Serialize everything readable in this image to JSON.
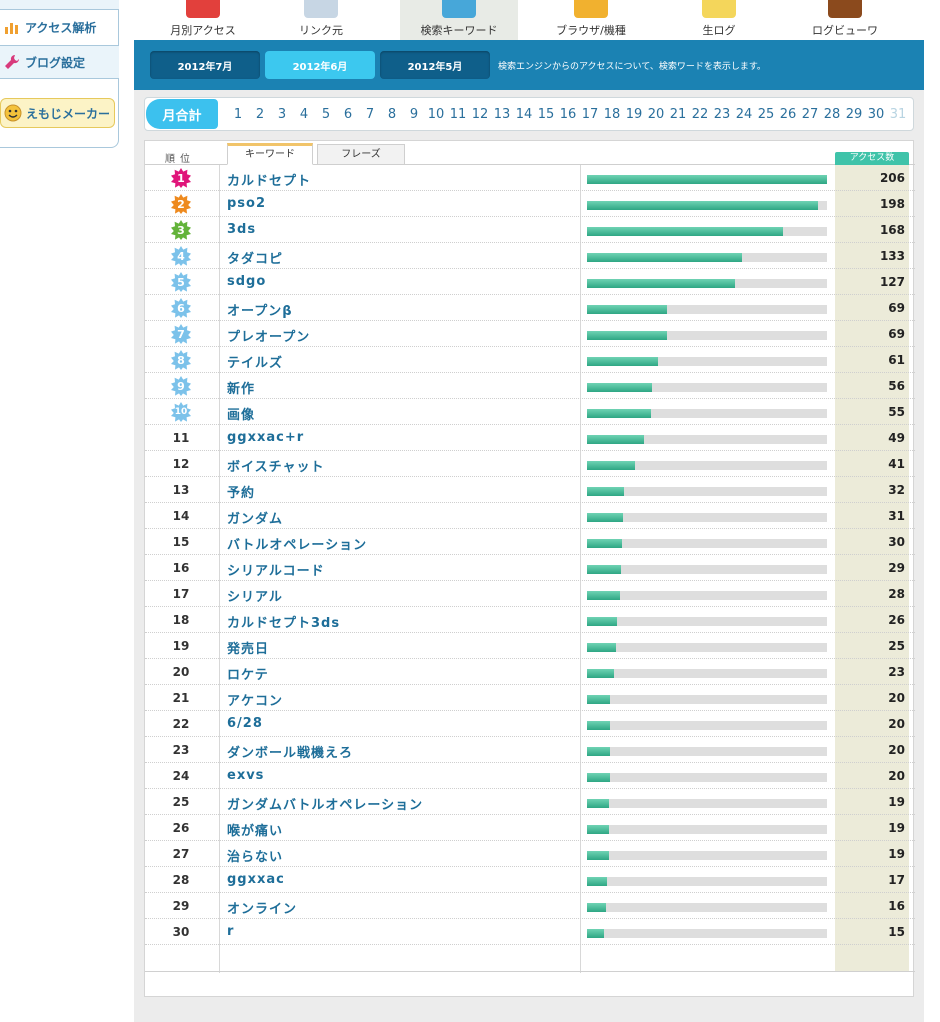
{
  "sidebar": {
    "items": [
      {
        "label": "アクセス解析",
        "icon": "bar-chart-icon"
      },
      {
        "label": "ブログ設定",
        "icon": "wrench-icon"
      },
      {
        "label": "えもじメーカー",
        "icon": "smiley-icon"
      }
    ]
  },
  "nav": {
    "items": [
      {
        "label": "月別アクセス",
        "icon": "bar-chart-icon",
        "color": "#e2403c"
      },
      {
        "label": "リンク元",
        "icon": "document-icon",
        "color": "#c7d6e4"
      },
      {
        "label": "検索キーワード",
        "icon": "magnifier-icon",
        "color": "#47a7d9"
      },
      {
        "label": "ブラウザ/機種",
        "icon": "pie-chart-icon",
        "color": "#f1b12f"
      },
      {
        "label": "生ログ",
        "icon": "notepad-icon",
        "color": "#f4d65b"
      },
      {
        "label": "ログビューワ",
        "icon": "logo-icon",
        "color": "#8b4a1d"
      }
    ],
    "active_index": 2
  },
  "months": {
    "tabs": [
      "2012年7月",
      "2012年6月",
      "2012年5月"
    ],
    "active_index": 1,
    "description": "検索エンジンからのアクセスについて、検索ワードを表示します。"
  },
  "days": {
    "total_label": "月合計",
    "list": [
      "1",
      "2",
      "3",
      "4",
      "5",
      "6",
      "7",
      "8",
      "9",
      "10",
      "11",
      "12",
      "13",
      "14",
      "15",
      "16",
      "17",
      "18",
      "19",
      "20",
      "21",
      "22",
      "23",
      "24",
      "25",
      "26",
      "27",
      "28",
      "29",
      "30",
      "31"
    ],
    "disabled": [
      "31"
    ]
  },
  "table": {
    "rank_header": "順位",
    "tab_keyword": "キーワード",
    "tab_phrase": "フレーズ",
    "count_header": "アクセス数",
    "max_count": 206,
    "badge_colors": [
      "#e0157a",
      "#ee8a1f",
      "#63b33a",
      "#7cc2ea",
      "#7cc2ea",
      "#7cc2ea",
      "#7cc2ea",
      "#7cc2ea",
      "#7cc2ea",
      "#7cc2ea"
    ],
    "rows": [
      {
        "rank": "1",
        "keyword": "カルドセプト",
        "count": 206
      },
      {
        "rank": "2",
        "keyword": "pso2",
        "count": 198
      },
      {
        "rank": "3",
        "keyword": "3ds",
        "count": 168
      },
      {
        "rank": "4",
        "keyword": "タダコピ",
        "count": 133
      },
      {
        "rank": "5",
        "keyword": "sdgo",
        "count": 127
      },
      {
        "rank": "6",
        "keyword": "オープンβ",
        "count": 69
      },
      {
        "rank": "7",
        "keyword": "プレオープン",
        "count": 69
      },
      {
        "rank": "8",
        "keyword": "テイルズ",
        "count": 61
      },
      {
        "rank": "9",
        "keyword": "新作",
        "count": 56
      },
      {
        "rank": "10",
        "keyword": "画像",
        "count": 55
      },
      {
        "rank": "11",
        "keyword": "ggxxac+r",
        "count": 49
      },
      {
        "rank": "12",
        "keyword": "ボイスチャット",
        "count": 41
      },
      {
        "rank": "13",
        "keyword": "予約",
        "count": 32
      },
      {
        "rank": "14",
        "keyword": "ガンダム",
        "count": 31
      },
      {
        "rank": "15",
        "keyword": "バトルオペレーション",
        "count": 30
      },
      {
        "rank": "16",
        "keyword": "シリアルコード",
        "count": 29
      },
      {
        "rank": "17",
        "keyword": "シリアル",
        "count": 28
      },
      {
        "rank": "18",
        "keyword": "カルドセプト3ds",
        "count": 26
      },
      {
        "rank": "19",
        "keyword": "発売日",
        "count": 25
      },
      {
        "rank": "20",
        "keyword": "ロケテ",
        "count": 23
      },
      {
        "rank": "21",
        "keyword": "アケコン",
        "count": 20
      },
      {
        "rank": "22",
        "keyword": "6/28",
        "count": 20
      },
      {
        "rank": "23",
        "keyword": "ダンボール戦機えろ",
        "count": 20
      },
      {
        "rank": "24",
        "keyword": "exvs",
        "count": 20
      },
      {
        "rank": "25",
        "keyword": "ガンダムバトルオペレーション",
        "count": 19
      },
      {
        "rank": "26",
        "keyword": "喉が痛い",
        "count": 19
      },
      {
        "rank": "27",
        "keyword": "治らない",
        "count": 19
      },
      {
        "rank": "28",
        "keyword": "ggxxac",
        "count": 17
      },
      {
        "rank": "29",
        "keyword": "オンライン",
        "count": 16
      },
      {
        "rank": "30",
        "keyword": "r",
        "count": 15
      }
    ]
  }
}
